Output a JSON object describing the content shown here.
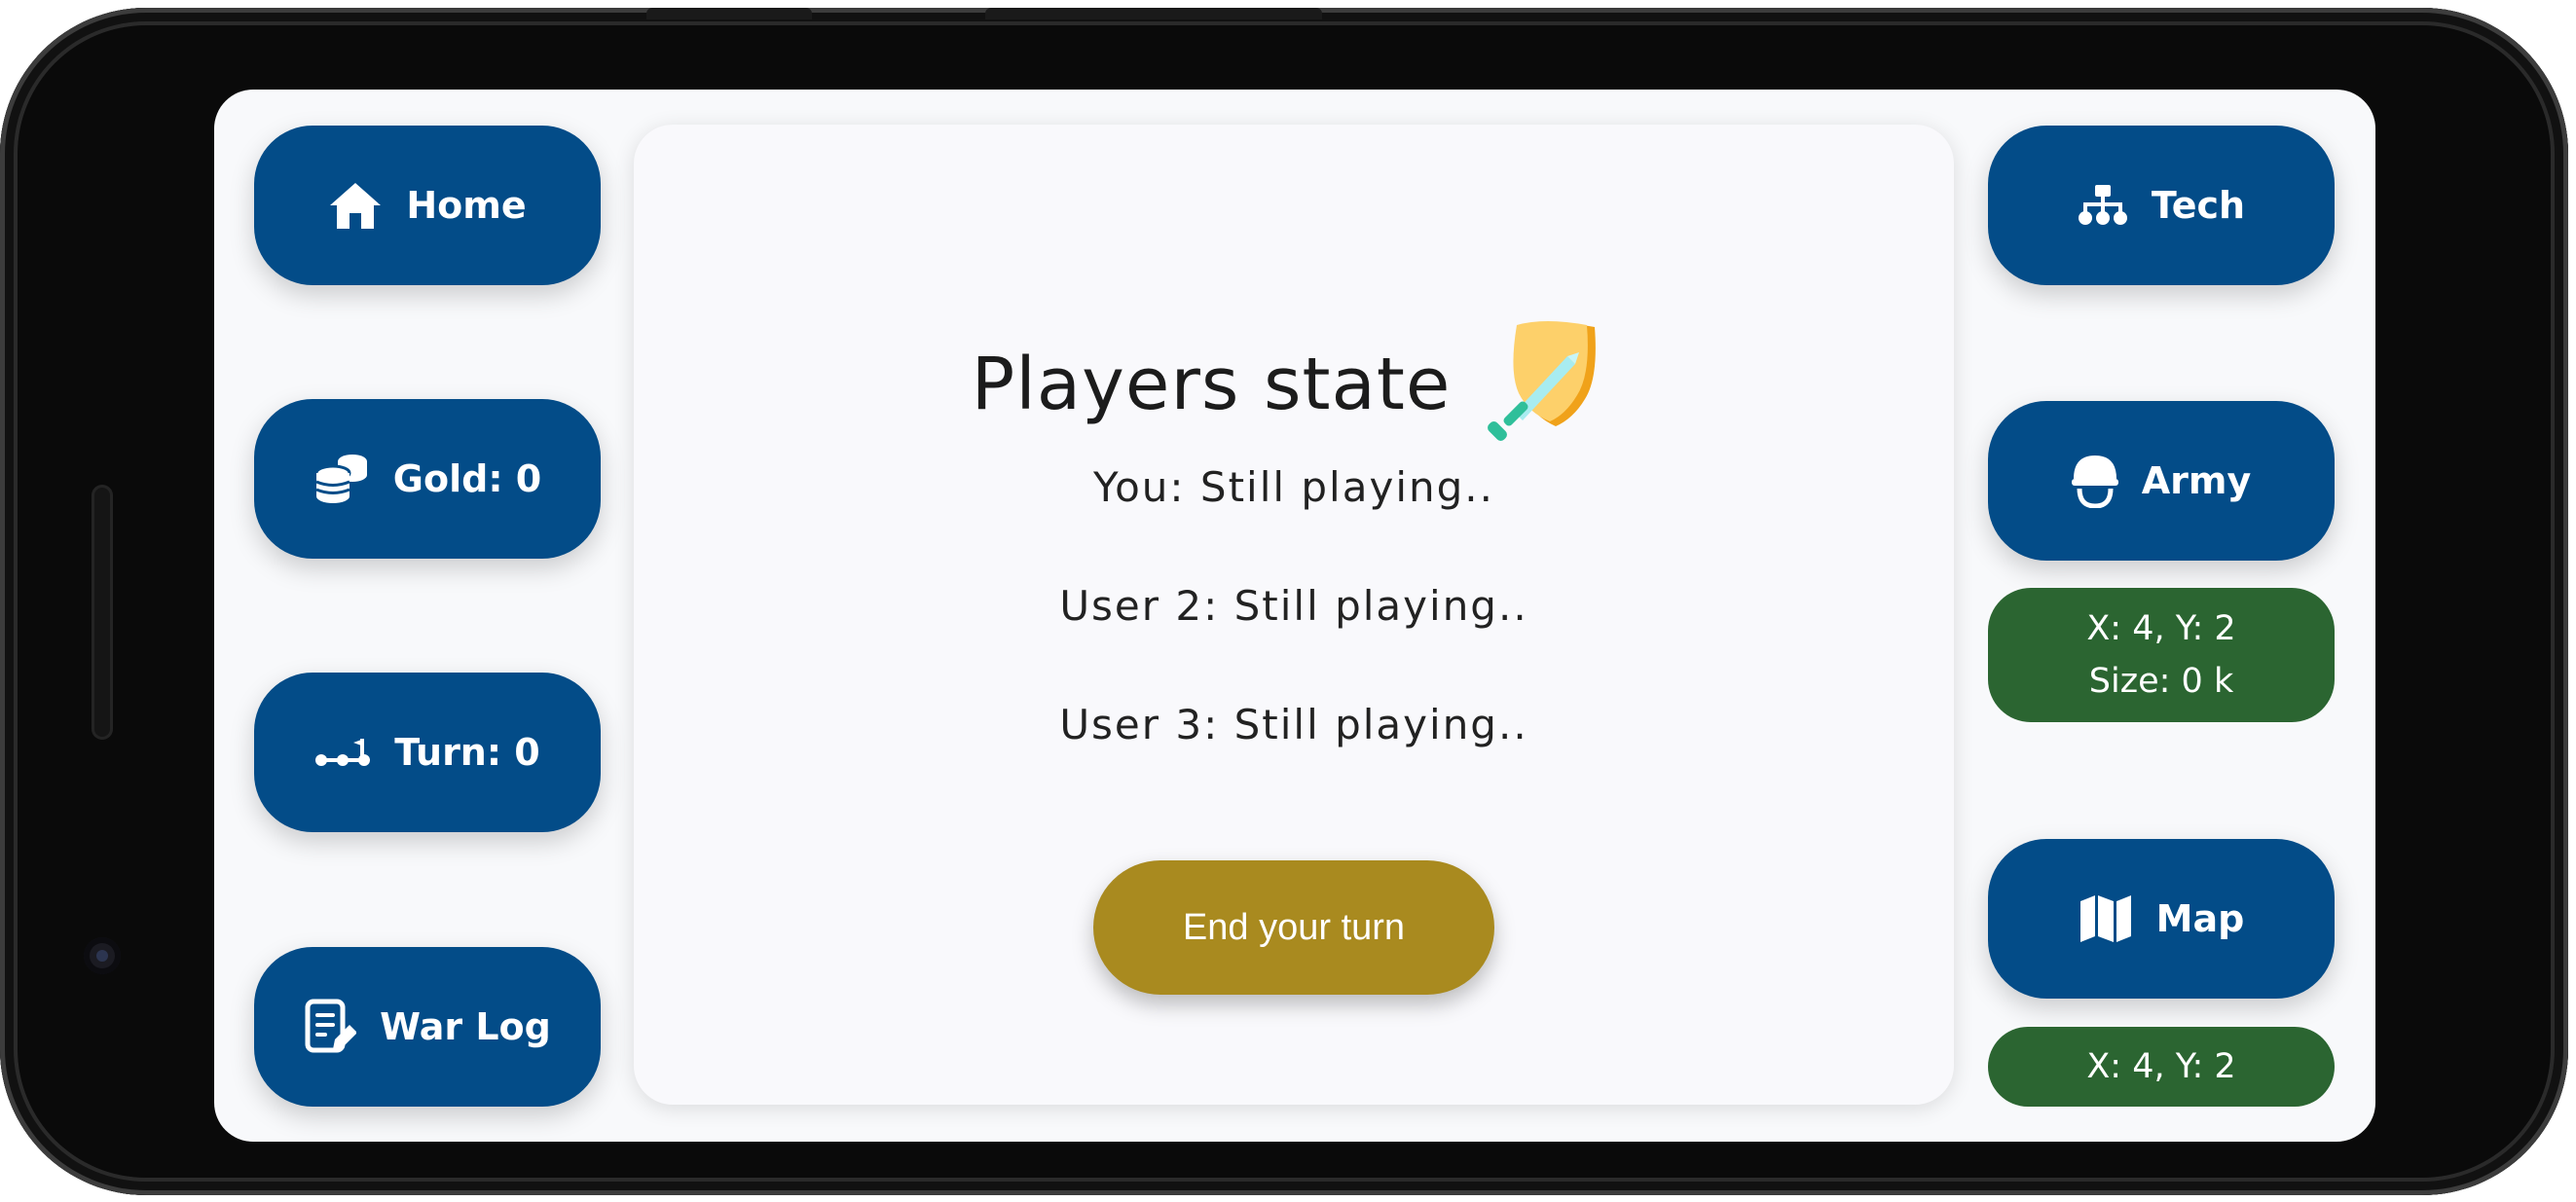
{
  "left_nav": {
    "home": {
      "label": "Home",
      "icon": "home-icon"
    },
    "gold": {
      "label": "Gold: 0",
      "icon": "coins-icon"
    },
    "turn": {
      "label": "Turn: 0",
      "icon": "route-icon"
    },
    "war_log": {
      "label": "War Log",
      "icon": "log-icon"
    }
  },
  "right_nav": {
    "tech": {
      "label": "Tech",
      "icon": "tech-tree-icon"
    },
    "army": {
      "label": "Army",
      "icon": "helmet-icon"
    },
    "army_info": {
      "coords": "X: 4, Y: 2",
      "size": "Size: 0 k"
    },
    "map": {
      "label": "Map",
      "icon": "map-icon"
    },
    "map_info": {
      "coords": "X: 4, Y: 2"
    }
  },
  "panel": {
    "title": "Players state",
    "title_icon": "shield-sword-icon",
    "statuses": [
      "You: Still playing..",
      "User 2: Still playing..",
      "User 3: Still playing.."
    ],
    "end_turn_label": "End your turn"
  },
  "colors": {
    "nav_blue": "#034c88",
    "info_green": "#2b6531",
    "end_turn_gold": "#a98a1f",
    "panel_bg": "#f9f9fc"
  }
}
